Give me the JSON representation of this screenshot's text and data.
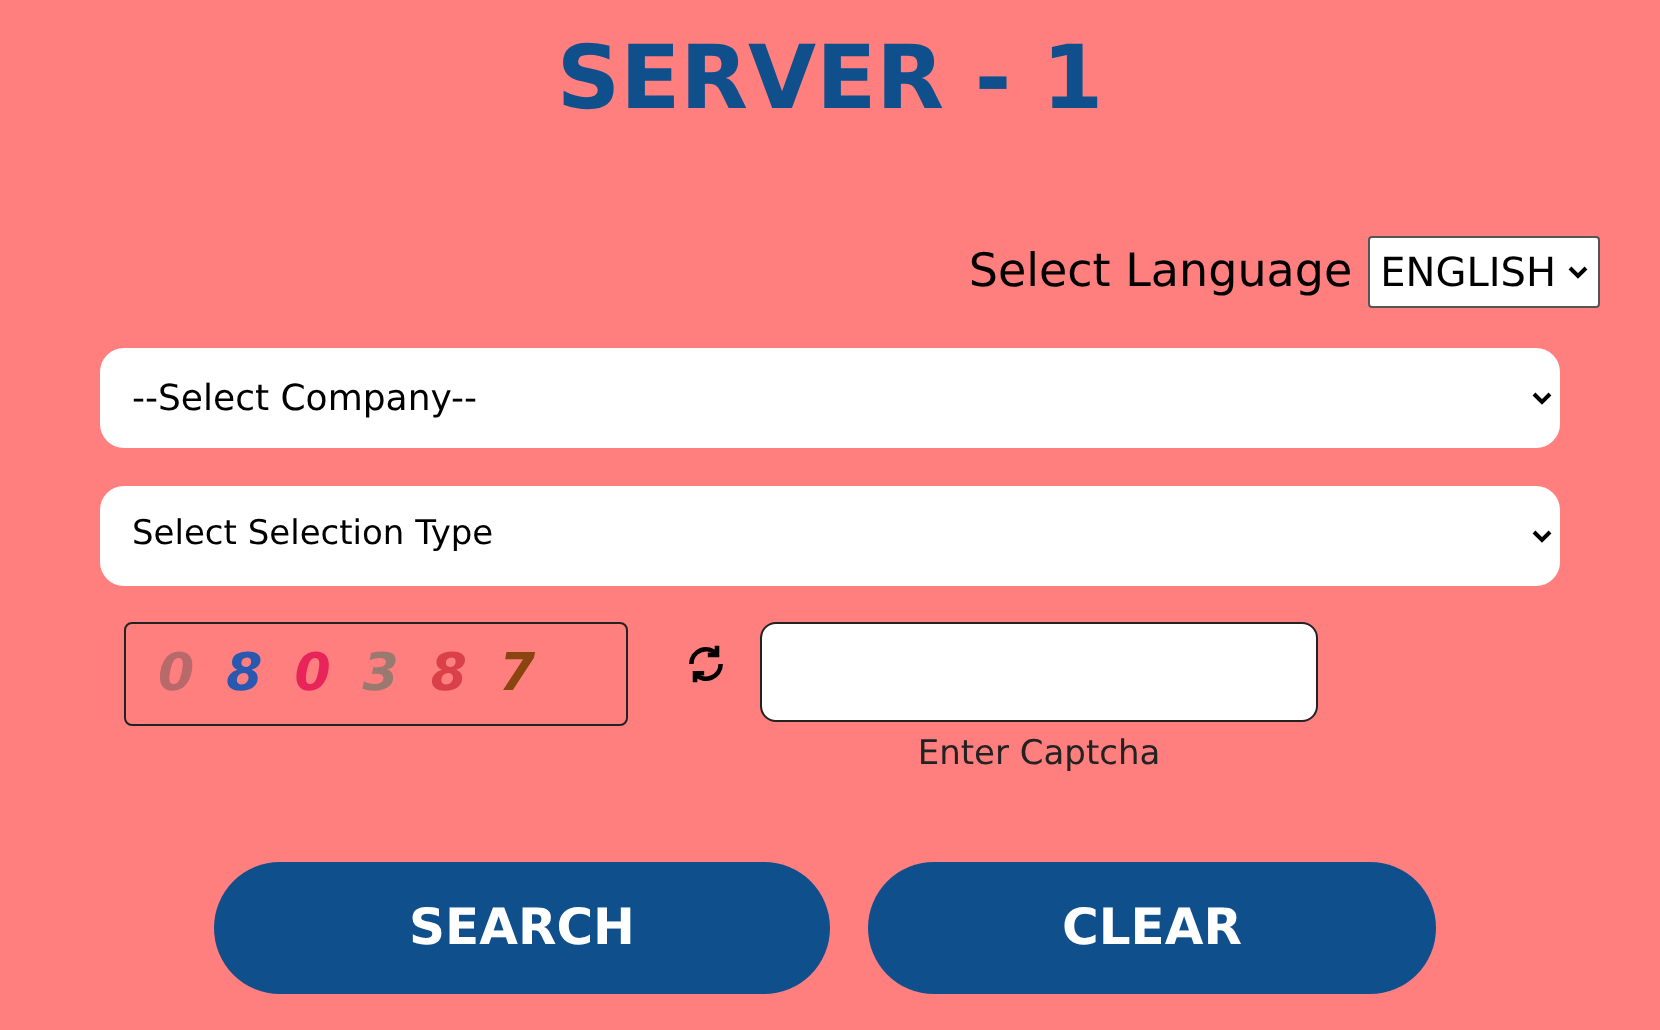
{
  "title": "SERVER - 1",
  "language": {
    "label": "Select Language",
    "value": "ENGLISH"
  },
  "company_select": {
    "value": "--Select Company--"
  },
  "selection_type_select": {
    "value": "Select Selection Type"
  },
  "captcha": {
    "digits": [
      {
        "text": "0",
        "color": "#b86a6a"
      },
      {
        "text": "8",
        "color": "#2858b0"
      },
      {
        "text": "0",
        "color": "#e8245a"
      },
      {
        "text": "3",
        "color": "#9a7a70"
      },
      {
        "text": "8",
        "color": "#d9404a"
      },
      {
        "text": "7",
        "color": "#8a4410"
      }
    ],
    "input_label": "Enter Captcha"
  },
  "buttons": [
    {
      "label": "SEARCH"
    },
    {
      "label": "CLEAR"
    }
  ]
}
